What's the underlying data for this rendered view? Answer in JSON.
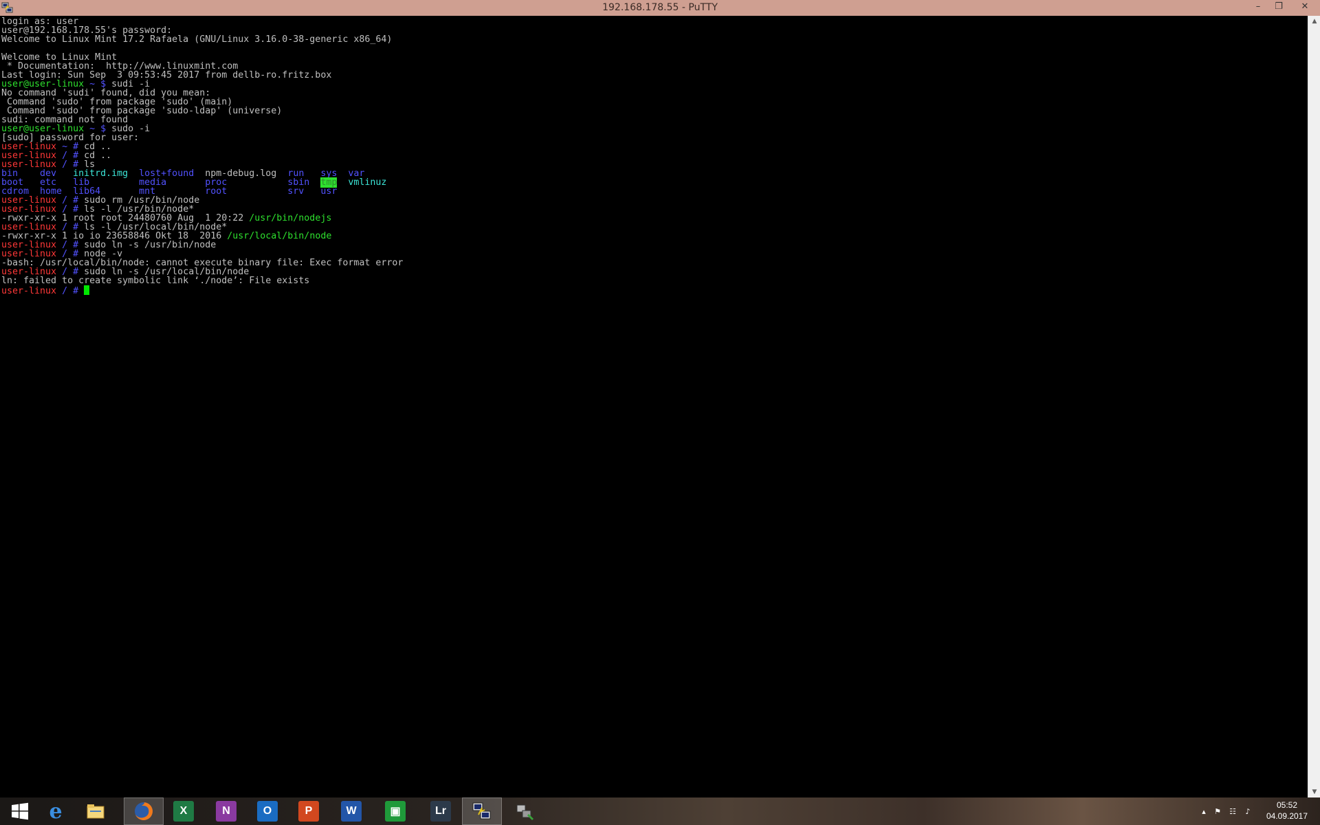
{
  "window": {
    "title": "192.168.178.55 - PuTTY",
    "app_icon": "putty-icon",
    "controls": [
      {
        "name": "minimize",
        "glyph": "–"
      },
      {
        "name": "maximize",
        "glyph": "❐"
      },
      {
        "name": "close",
        "glyph": "✕"
      }
    ]
  },
  "terminal": {
    "lines": [
      [
        {
          "t": "login as: user",
          "c": "gray"
        }
      ],
      [
        {
          "t": "user@192.168.178.55's password:",
          "c": "gray"
        }
      ],
      [
        {
          "t": "Welcome to Linux Mint 17.2 Rafaela (GNU/Linux 3.16.0-38-generic x86_64)",
          "c": "gray"
        }
      ],
      [],
      [
        {
          "t": "Welcome to Linux Mint",
          "c": "gray"
        }
      ],
      [
        {
          "t": " * Documentation:  http://www.linuxmint.com",
          "c": "gray"
        }
      ],
      [
        {
          "t": "Last login: Sun Sep  3 09:53:45 2017 from dellb-ro.fritz.box",
          "c": "gray"
        }
      ],
      [
        {
          "t": "user@user-linux",
          "c": "green"
        },
        {
          "t": " ~ $ ",
          "c": "blue"
        },
        {
          "t": "sudi -i",
          "c": "gray"
        }
      ],
      [
        {
          "t": "No command 'sudi' found, did you mean:",
          "c": "gray"
        }
      ],
      [
        {
          "t": " Command 'sudo' from package 'sudo' (main)",
          "c": "gray"
        }
      ],
      [
        {
          "t": " Command 'sudo' from package 'sudo-ldap' (universe)",
          "c": "gray"
        }
      ],
      [
        {
          "t": "sudi: command not found",
          "c": "gray"
        }
      ],
      [
        {
          "t": "user@user-linux",
          "c": "green"
        },
        {
          "t": " ~ $ ",
          "c": "blue"
        },
        {
          "t": "sudo -i",
          "c": "gray"
        }
      ],
      [
        {
          "t": "[sudo] password for user:",
          "c": "gray"
        }
      ],
      [
        {
          "t": "user-linux",
          "c": "red"
        },
        {
          "t": " ~ # ",
          "c": "blue"
        },
        {
          "t": "cd ..",
          "c": "gray"
        }
      ],
      [
        {
          "t": "user-linux",
          "c": "red"
        },
        {
          "t": " / # ",
          "c": "blue"
        },
        {
          "t": "cd ..",
          "c": "gray"
        }
      ],
      [
        {
          "t": "user-linux",
          "c": "red"
        },
        {
          "t": " / # ",
          "c": "blue"
        },
        {
          "t": "ls",
          "c": "gray"
        }
      ],
      [
        {
          "t": "bin    dev   ",
          "c": "blue"
        },
        {
          "t": "initrd.img",
          "c": "cyan"
        },
        {
          "t": "  lost+found  ",
          "c": "blue"
        },
        {
          "t": "npm-debug.log  ",
          "c": "gray"
        },
        {
          "t": "run   sys  ",
          "c": "blue"
        },
        {
          "t": "var",
          "c": "blue"
        }
      ],
      [
        {
          "t": "boot   etc   lib         media       proc           sbin  ",
          "c": "blue"
        },
        {
          "t": "tmp",
          "c": "hl"
        },
        {
          "t": "  ",
          "c": "gray"
        },
        {
          "t": "vmlinuz",
          "c": "cyan"
        }
      ],
      [
        {
          "t": "cdrom  home  lib64       mnt         root           srv   usr",
          "c": "blue"
        }
      ],
      [
        {
          "t": "user-linux",
          "c": "red"
        },
        {
          "t": " / # ",
          "c": "blue"
        },
        {
          "t": "sudo rm /usr/bin/node",
          "c": "gray"
        }
      ],
      [
        {
          "t": "user-linux",
          "c": "red"
        },
        {
          "t": " / # ",
          "c": "blue"
        },
        {
          "t": "ls -l /usr/bin/node*",
          "c": "gray"
        }
      ],
      [
        {
          "t": "-rwxr-xr-x 1 root root 24480760 Aug  1 20:22 ",
          "c": "gray"
        },
        {
          "t": "/usr/bin/nodejs",
          "c": "green"
        }
      ],
      [
        {
          "t": "user-linux",
          "c": "red"
        },
        {
          "t": " / # ",
          "c": "blue"
        },
        {
          "t": "ls -l /usr/local/bin/node*",
          "c": "gray"
        }
      ],
      [
        {
          "t": "-rwxr-xr-x 1 io io 23658846 Okt 18  2016 ",
          "c": "gray"
        },
        {
          "t": "/usr/local/bin/node",
          "c": "green"
        }
      ],
      [
        {
          "t": "user-linux",
          "c": "red"
        },
        {
          "t": " / # ",
          "c": "blue"
        },
        {
          "t": "sudo ln -s /usr/bin/node",
          "c": "gray"
        }
      ],
      [
        {
          "t": "user-linux",
          "c": "red"
        },
        {
          "t": " / # ",
          "c": "blue"
        },
        {
          "t": "node -v",
          "c": "gray"
        }
      ],
      [
        {
          "t": "-bash: /usr/local/bin/node: cannot execute binary file: Exec format error",
          "c": "gray"
        }
      ],
      [
        {
          "t": "user-linux",
          "c": "red"
        },
        {
          "t": " / # ",
          "c": "blue"
        },
        {
          "t": "sudo ln -s /usr/local/bin/node",
          "c": "gray"
        }
      ],
      [
        {
          "t": "ln: failed to create symbolic link ‘./node’: File exists",
          "c": "gray"
        }
      ],
      [
        {
          "t": "user-linux",
          "c": "red"
        },
        {
          "t": " / # ",
          "c": "blue"
        }
      ]
    ],
    "cursor_line": 30,
    "colors": {
      "red": "#ff3838",
      "green": "#2ee02e",
      "blue": "#5252ff",
      "cyan": "#3ce6d8",
      "gray": "#c0c0c0",
      "cursor": "#00e800"
    }
  },
  "scrollbar": {
    "up": "▲",
    "down": "▼"
  },
  "taskbar": {
    "apps": [
      {
        "name": "start-button",
        "icon": "windows-logo-icon",
        "label": "",
        "color": "#1e90ff"
      },
      {
        "name": "internet-explorer",
        "icon": "internet-explorer-icon",
        "label": "e",
        "color": "#2a7fd4"
      },
      {
        "name": "file-explorer",
        "icon": "file-explorer-icon",
        "label": "",
        "color": "#e8c15a"
      },
      {
        "name": "firefox",
        "icon": "firefox-icon",
        "label": "",
        "color": "#e66a1c"
      },
      {
        "name": "excel",
        "icon": "excel-icon",
        "label": "X",
        "color": "#1f7a44"
      },
      {
        "name": "onenote",
        "icon": "onenote-icon",
        "label": "N",
        "color": "#8a3aa0"
      },
      {
        "name": "outlook",
        "icon": "outlook-icon",
        "label": "O",
        "color": "#1a6cc2"
      },
      {
        "name": "powerpoint",
        "icon": "powerpoint-icon",
        "label": "P",
        "color": "#d2481f"
      },
      {
        "name": "word",
        "icon": "word-icon",
        "label": "W",
        "color": "#2356a8"
      },
      {
        "name": "store",
        "icon": "store-icon",
        "label": "▣",
        "color": "#1f9a3a"
      },
      {
        "name": "lightroom",
        "icon": "lightroom-icon",
        "label": "Lr",
        "color": "#2c3a4a"
      },
      {
        "name": "putty",
        "icon": "putty-icon",
        "label": "",
        "color": "#6a7aa8"
      },
      {
        "name": "network-tool",
        "icon": "network-tool-icon",
        "label": "",
        "color": "#4a4a4a"
      }
    ],
    "tray": [
      {
        "name": "show-hidden-icons",
        "glyph": "▴"
      },
      {
        "name": "action-center-flag",
        "glyph": "⚑"
      },
      {
        "name": "network",
        "glyph": "☷"
      },
      {
        "name": "volume",
        "glyph": "♪"
      }
    ],
    "clock": {
      "time": "05:52",
      "date": "04.09.2017"
    }
  }
}
